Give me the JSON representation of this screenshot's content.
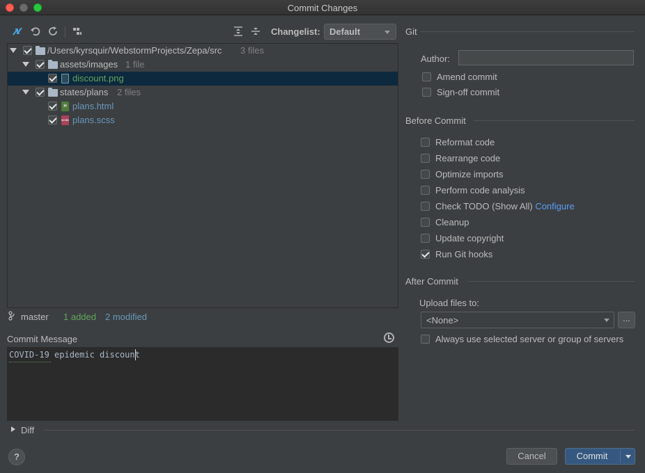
{
  "window": {
    "title": "Commit Changes"
  },
  "toolbar": {
    "changelist_label": "Changelist:",
    "changelist_value": "Default"
  },
  "tree": {
    "root": {
      "path": "/Users/kyrsquir/WebstormProjects/Zepa/src",
      "count": "3 files"
    },
    "folder1": {
      "name": "assets/images",
      "count": "1 file"
    },
    "file1": {
      "name": "discount.png",
      "color": "#62a35c"
    },
    "folder2": {
      "name": "states/plans",
      "count": "2 files"
    },
    "file2": {
      "name": "plans.html",
      "color": "#6897bb",
      "icon_text": "H"
    },
    "file3": {
      "name": "plans.scss",
      "color": "#6897bb",
      "icon_text": "SCSS"
    }
  },
  "status": {
    "branch": "master",
    "added": "1 added",
    "modified": "2 modified"
  },
  "commit_message": {
    "label": "Commit Message",
    "text": "COVID-19 epidemic discount"
  },
  "diff": {
    "label": "Diff"
  },
  "git": {
    "title": "Git",
    "author_label": "Author:",
    "author_value": "",
    "amend": {
      "label": "Amend commit",
      "checked": false
    },
    "signoff": {
      "label": "Sign-off commit",
      "checked": false
    }
  },
  "before_commit": {
    "title": "Before Commit",
    "reformat": {
      "label": "Reformat code",
      "checked": false
    },
    "rearrange": {
      "label": "Rearrange code",
      "checked": false
    },
    "optimize": {
      "label": "Optimize imports",
      "checked": false
    },
    "analysis": {
      "label": "Perform code analysis",
      "checked": false
    },
    "todo": {
      "label": "Check TODO (Show All)",
      "link": "Configure",
      "checked": false
    },
    "cleanup": {
      "label": "Cleanup",
      "checked": false
    },
    "copyright": {
      "label": "Update copyright",
      "checked": false
    },
    "githooks": {
      "label": "Run Git hooks",
      "checked": true
    }
  },
  "after_commit": {
    "title": "After Commit",
    "upload_label": "Upload files to:",
    "server_value": "<None>",
    "browse_label": "...",
    "always_use": {
      "label": "Always use selected server or group of servers",
      "checked": false
    }
  },
  "footer": {
    "help_label": "?",
    "cancel_label": "Cancel",
    "commit_label": "Commit"
  },
  "colors": {
    "background": "#3c3f41",
    "selection": "#0d293e",
    "added_green": "#62a35c",
    "modified_blue": "#6897bb",
    "link_blue": "#589df6",
    "commit_button": "#365880"
  }
}
